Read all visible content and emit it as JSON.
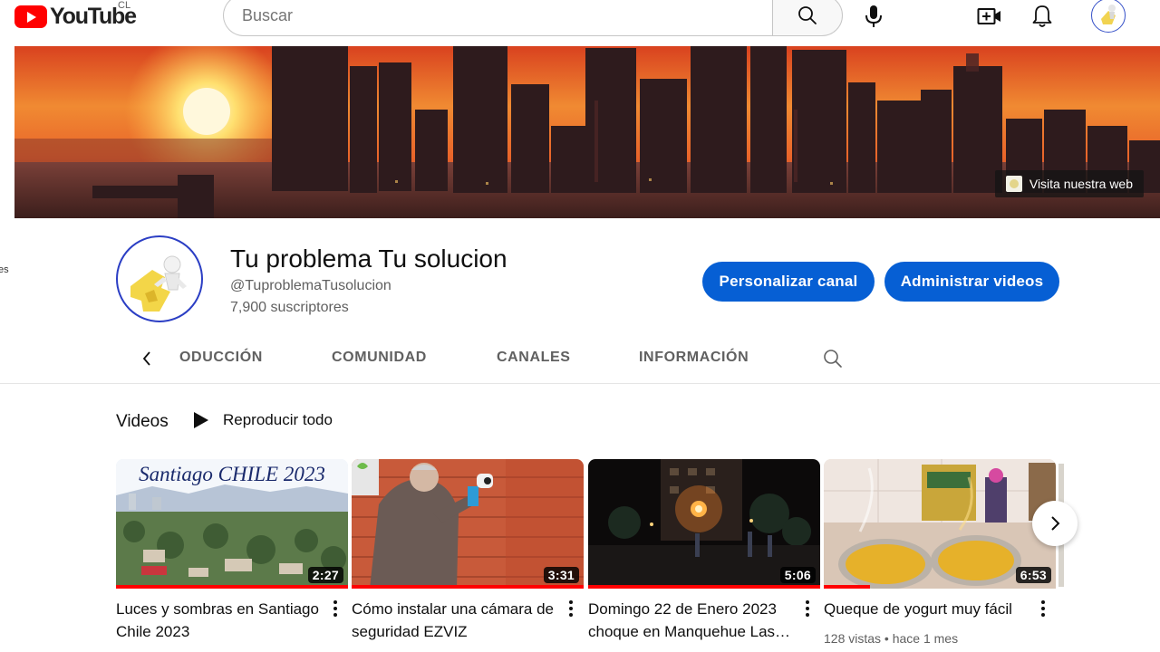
{
  "header": {
    "logo_text": "YouTube",
    "country_code": "CL",
    "search_placeholder": "Buscar",
    "icons": {
      "search": "search-icon",
      "mic": "mic-icon",
      "create": "create-video-icon",
      "notifications": "bell-icon",
      "account": "avatar"
    }
  },
  "banner": {
    "link_label": "Visita nuestra web"
  },
  "side_text": "es",
  "channel": {
    "name": "Tu problema Tu solucion",
    "handle": "@TuproblemaTusolucion",
    "subscribers": "7,900 suscriptores",
    "customize_label": "Personalizar canal",
    "manage_label": "Administrar videos"
  },
  "tabs": [
    {
      "label": "ODUCCIÓN"
    },
    {
      "label": "COMUNIDAD"
    },
    {
      "label": "CANALES"
    },
    {
      "label": "INFORMACIÓN"
    }
  ],
  "section": {
    "title": "Videos",
    "play_all_label": "Reproducir todo"
  },
  "videos": [
    {
      "title": "Luces y sombras en Santiago Chile 2023",
      "duration": "2:27",
      "thumb_text": "Santiago CHILE 2023",
      "watched": 1.0,
      "meta": ""
    },
    {
      "title": "Cómo instalar una cámara de seguridad EZVIZ",
      "duration": "3:31",
      "thumb_text": "",
      "watched": 1.0,
      "meta": ""
    },
    {
      "title": "Domingo 22 de Enero 2023 choque en Manquehue Las…",
      "duration": "5:06",
      "thumb_text": "",
      "watched": 1.0,
      "meta": ""
    },
    {
      "title": "Queque de yogurt muy fácil",
      "duration": "6:53",
      "thumb_text": "",
      "watched": 0.2,
      "meta": "128 vistas • hace 1 mes"
    }
  ],
  "colors": {
    "brand_red": "#ff0000",
    "primary_blue": "#065fd4",
    "text_primary": "#0f0f0f",
    "text_secondary": "#606060"
  }
}
